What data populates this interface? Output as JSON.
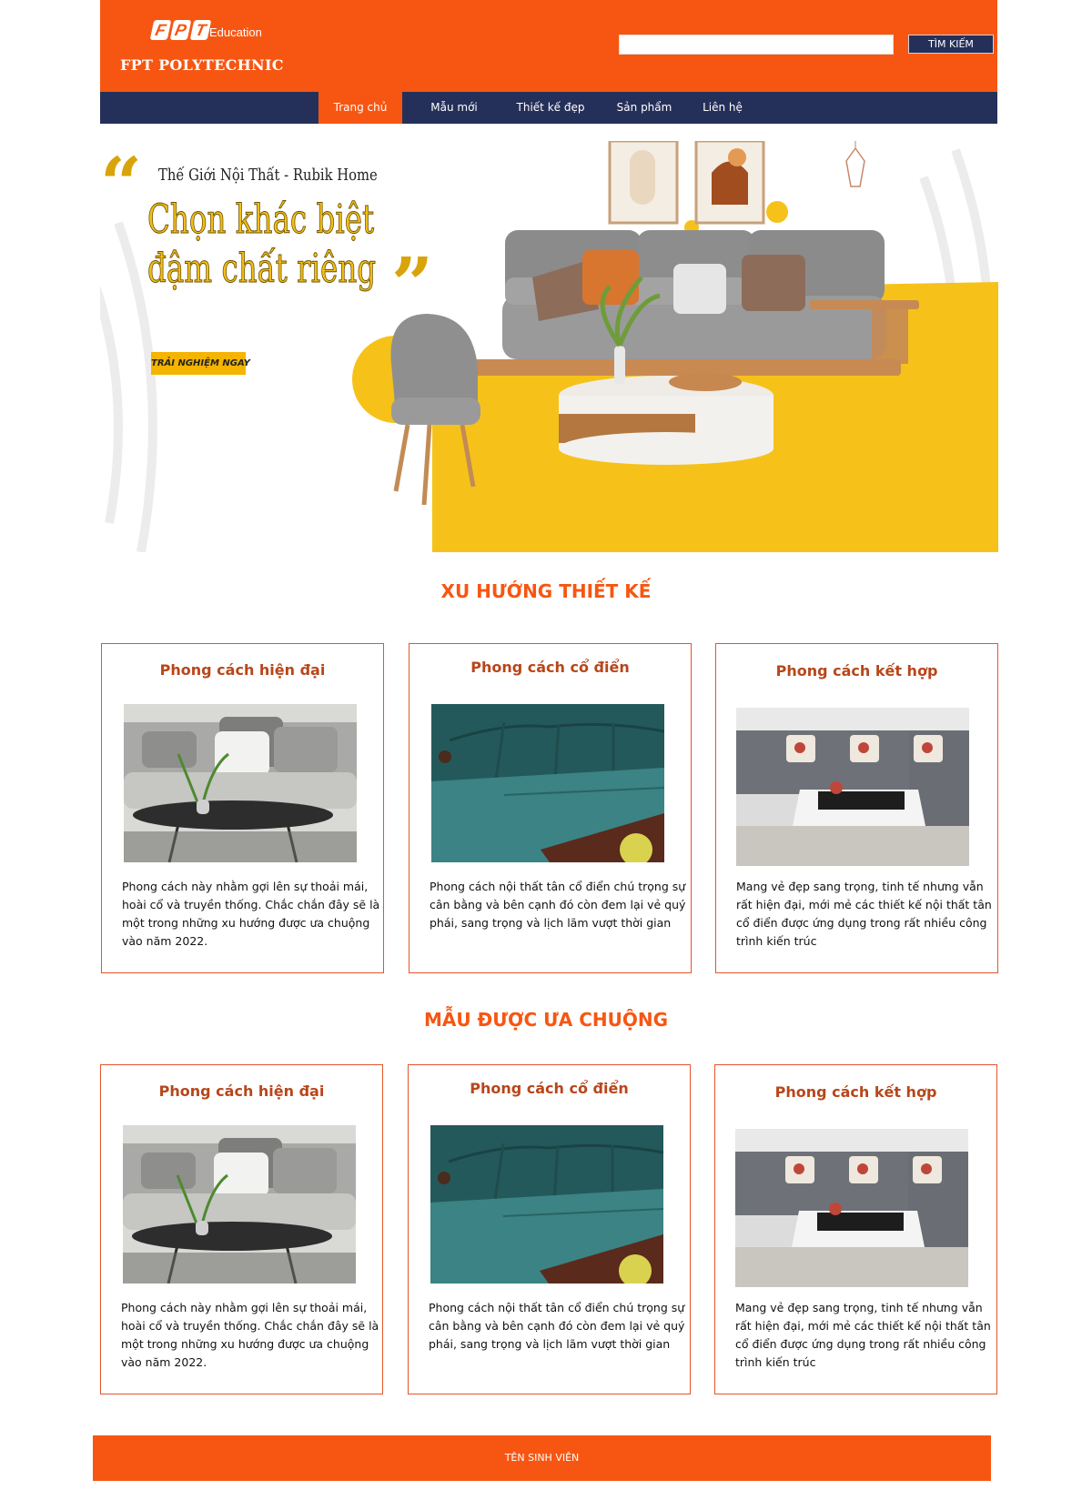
{
  "header": {
    "logo": {
      "brand_letters": [
        "F",
        "P",
        "T"
      ],
      "education": "Education",
      "name": "FPT POLYTECHNIC"
    },
    "search": {
      "placeholder": "",
      "value": "",
      "button_label": "TÌM KIẾM"
    }
  },
  "nav": {
    "items": [
      {
        "label": "Trang chủ",
        "active": true
      },
      {
        "label": "Mẫu mới",
        "active": false
      },
      {
        "label": "Thiết kế đẹp",
        "active": false
      },
      {
        "label": "Sản phẩm",
        "active": false
      },
      {
        "label": "Liên hệ",
        "active": false
      }
    ]
  },
  "banner": {
    "subtitle": "Thế Giới Nội Thất - Rubik Home",
    "title_line1": "Chọn khác biệt",
    "title_line2": "đậm chất riêng",
    "cta_label": "TRẢI NGHIỆM NGAY"
  },
  "sections": [
    {
      "title": "XU HƯỚNG THIẾT KẾ",
      "cards": [
        {
          "title": "Phong cách hiện đại",
          "image": "modern-sofa-photo",
          "text": "Phong cách này nhằm gợi lên sự thoải mái, hoài cổ và truyền thống. Chắc chắn đây sẽ là một trong những xu hướng được ưa chuộng vào năm 2022."
        },
        {
          "title": "Phong cách cổ điển",
          "image": "classic-leather-sofa-photo",
          "text": "Phong cách nội thất tân cổ điển chú trọng sự cân bằng và bên cạnh đó còn đem lại vẻ quý phái, sang trọng và lịch lãm vượt thời gian"
        },
        {
          "title": "Phong cách kết hợp",
          "image": "mixed-style-sofa-photo",
          "text": "Mang vẻ đẹp sang trọng, tinh tế nhưng vẫn rất hiện đại, mới mẻ các thiết kế nội thất tân cổ điển được ứng dụng trong rất nhiều công trình kiến trúc"
        }
      ]
    },
    {
      "title": "MẪU ĐƯỢC ƯA CHUỘNG",
      "cards": [
        {
          "title": "Phong cách hiện đại",
          "image": "modern-sofa-photo",
          "text": "Phong cách này nhằm gợi lên sự thoải mái, hoài cổ và truyền thống. Chắc chắn đây sẽ là một trong những xu hướng được ưa chuộng vào năm 2022."
        },
        {
          "title": "Phong cách cổ điển",
          "image": "classic-leather-sofa-photo",
          "text": "Phong cách nội thất tân cổ điển chú trọng sự cân bằng và bên cạnh đó còn đem lại vẻ quý phái, sang trọng và lịch lãm vượt thời gian"
        },
        {
          "title": "Phong cách kết hợp",
          "image": "mixed-style-sofa-photo",
          "text": "Mang vẻ đẹp sang trọng, tinh tế nhưng vẫn rất hiện đại, mới mẻ các thiết kế nội thất tân cổ điển được ứng dụng trong rất nhiều công trình kiến trúc"
        }
      ]
    }
  ],
  "footer": {
    "label": "TÊN SINH VIÊN"
  },
  "colors": {
    "brand_orange": "#f75612",
    "nav_navy": "#25305a",
    "banner_yellow": "#f6c21a",
    "card_title": "#b8461a"
  }
}
